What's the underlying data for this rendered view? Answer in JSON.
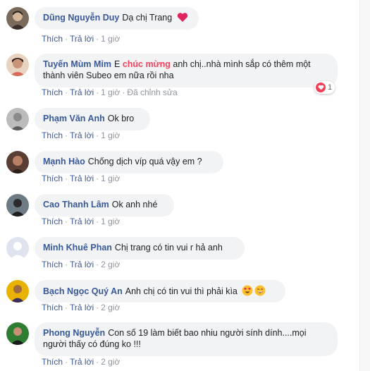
{
  "action_labels": {
    "like": "Thích",
    "reply": "Trả lời",
    "separator": "·",
    "edited": "Đã chỉnh sửa"
  },
  "comments": [
    {
      "name": "Dũng Nguyễn Duy",
      "text": "Dạ chị Trang",
      "time": "1 giờ",
      "emoji": [
        "heart"
      ]
    },
    {
      "name": "Tuyến Mùm Mỉm",
      "text_prefix": "E",
      "text_highlight": "chúc mừng",
      "text_line1_rest": "anh chị..nhà mình sắp có thêm một",
      "text_line2": "thành viên Subeo em nữa rồi nha",
      "time": "1 giờ",
      "edited": true,
      "reaction_count": "1"
    },
    {
      "name": "Phạm Văn Anh",
      "text": "Ok bro",
      "time": "1 giờ"
    },
    {
      "name": "Mạnh Hào",
      "text": "Chống dịch víp quá vậy em ?",
      "time": "1 giờ"
    },
    {
      "name": "Cao Thanh Lâm",
      "text": "Ok anh nhé",
      "time": "1 giờ"
    },
    {
      "name": "Minh Khuê Phan",
      "text": "Chị trang có tin vui r hả anh",
      "time": "2 giờ"
    },
    {
      "name": "Bạch Ngọc Quý An",
      "text": "Anh chị có tin vui thì phải kìa",
      "time": "2 giờ",
      "emoji": [
        "heart-eyes",
        "grin"
      ]
    },
    {
      "name": "Phong Nguyễn",
      "text_line1": "Con số 19 làm biết bao nhiu người sính dính....mọi",
      "text_line2": "người thấy có đúng ko !!!",
      "time": "2 giờ"
    }
  ],
  "colors": {
    "name": "#385898",
    "bubble": "#f2f3f5",
    "meta": "#90949c",
    "highlight": "#f3425f",
    "heart": "#f33e58"
  }
}
